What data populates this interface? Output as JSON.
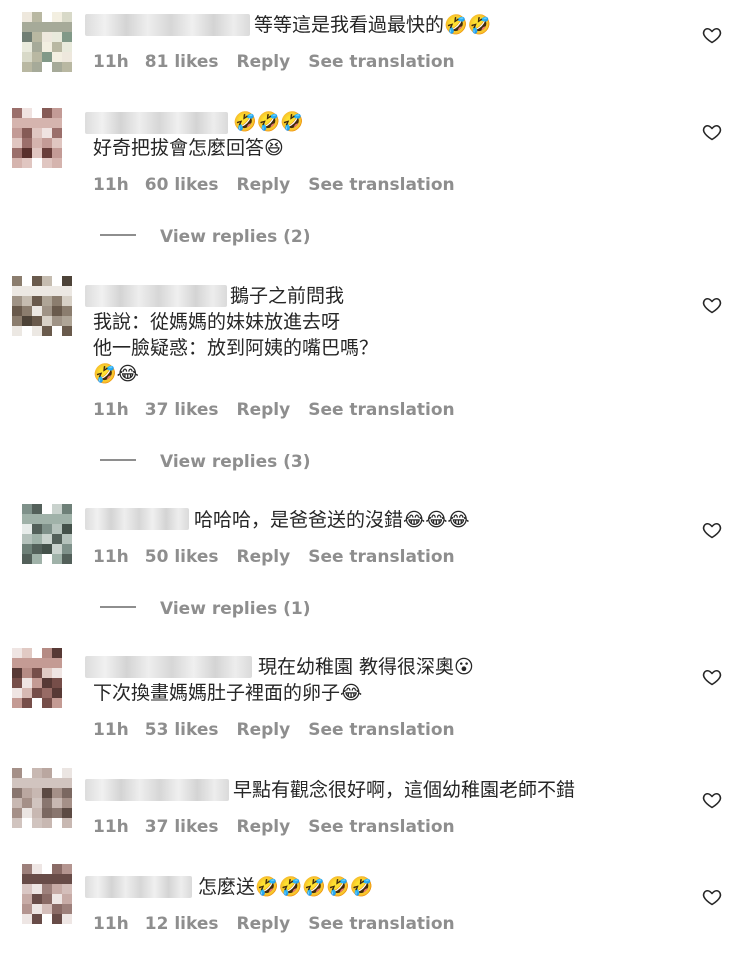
{
  "comments": [
    {
      "text": [
        "等等這是我看過最快的🤣🤣"
      ],
      "time": "11h",
      "likes": "81 likes",
      "reply": "Reply",
      "translate": "See translation"
    },
    {
      "text": [
        "🤣🤣🤣",
        "好奇把拔會怎麼回答😆"
      ],
      "time": "11h",
      "likes": "60 likes",
      "reply": "Reply",
      "translate": "See translation",
      "view_replies": "View replies (2)"
    },
    {
      "text": [
        "鵝子之前問我",
        "我說：從媽媽的妹妹放進去呀",
        "他一臉疑惑：放到阿姨的嘴巴嗎？",
        "🤣😂"
      ],
      "time": "11h",
      "likes": "37 likes",
      "reply": "Reply",
      "translate": "See translation",
      "view_replies": "View replies (3)"
    },
    {
      "text": [
        "哈哈哈，是爸爸送的沒錯😂😂😂"
      ],
      "time": "11h",
      "likes": "50 likes",
      "reply": "Reply",
      "translate": "See translation",
      "view_replies": "View replies (1)"
    },
    {
      "text": [
        "現在幼稚園 教得很深奧😮",
        "下次換畫媽媽肚子裡面的卵子😂"
      ],
      "time": "11h",
      "likes": "53 likes",
      "reply": "Reply",
      "translate": "See translation"
    },
    {
      "text": [
        "早點有觀念很好啊，這個幼稚園老師不錯"
      ],
      "time": "11h",
      "likes": "37 likes",
      "reply": "Reply",
      "translate": "See translation"
    },
    {
      "text": [
        "怎麼送🤣🤣🤣🤣🤣"
      ],
      "time": "11h",
      "likes": "12 likes",
      "reply": "Reply",
      "translate": "See translation"
    }
  ],
  "icons": {
    "like": "heart-outline-icon"
  }
}
